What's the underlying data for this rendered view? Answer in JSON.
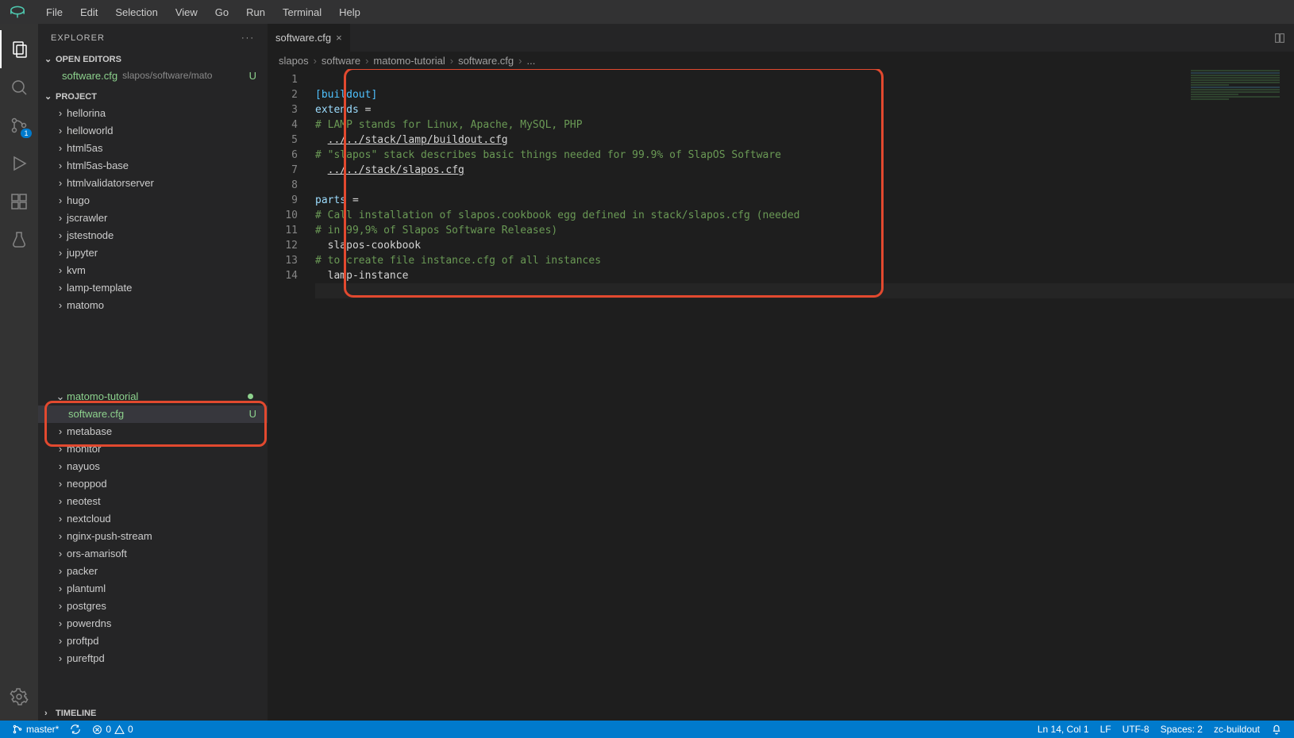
{
  "menu": [
    "File",
    "Edit",
    "Selection",
    "View",
    "Go",
    "Run",
    "Terminal",
    "Help"
  ],
  "sidebar": {
    "title": "EXPLORER",
    "openEditors": "OPEN EDITORS",
    "openEditorFile": "software.cfg",
    "openEditorPath": "slapos/software/mato",
    "openEditorStatus": "U",
    "projectHeader": "PROJECT",
    "folders": [
      "hellorina",
      "helloworld",
      "html5as",
      "html5as-base",
      "htmlvalidatorserver",
      "hugo",
      "jscrawler",
      "jstestnode",
      "jupyter",
      "kvm",
      "lamp-template",
      "matomo"
    ],
    "hlFolder": "matomo-tutorial",
    "hlFile": "software.cfg",
    "hlStatus": "U",
    "foldersAfter": [
      "metabase",
      "monitor",
      "nayuos",
      "neoppod",
      "neotest",
      "nextcloud",
      "nginx-push-stream",
      "ors-amarisoft",
      "packer",
      "plantuml",
      "postgres",
      "powerdns",
      "proftpd",
      "pureftpd"
    ],
    "timeline": "TIMELINE"
  },
  "scmBadge": "1",
  "tab": {
    "name": "software.cfg"
  },
  "breadcrumb": [
    "slapos",
    "software",
    "matomo-tutorial",
    "software.cfg",
    "..."
  ],
  "code": {
    "lines": 14,
    "l1_section": "[buildout]",
    "l2_key": "extends",
    "l2_op": " =",
    "l3_comment": "# LAMP stands for Linux, Apache, MySQL, PHP",
    "l4_indent": "  ",
    "l4_link": "../../stack/lamp/buildout.cfg",
    "l5_comment": "# \"slapos\" stack describes basic things needed for 99.9% of SlapOS Software",
    "l6_indent": "  ",
    "l6_link": "../../stack/slapos.cfg",
    "l8_key": "parts",
    "l8_op": " =",
    "l9_comment": "# Call installation of slapos.cookbook egg defined in stack/slapos.cfg (needed",
    "l10_comment": "# in 99,9% of Slapos Software Releases)",
    "l11_val": "  slapos-cookbook",
    "l12_comment": "# to create file instance.cfg of all instances",
    "l13_val": "  lamp-instance"
  },
  "status": {
    "branch": "master*",
    "errors": "0",
    "warnings": "0",
    "lncol": "Ln 14, Col 1",
    "eol": "LF",
    "enc": "UTF-8",
    "indent": "Spaces: 2",
    "lang": "zc-buildout"
  }
}
